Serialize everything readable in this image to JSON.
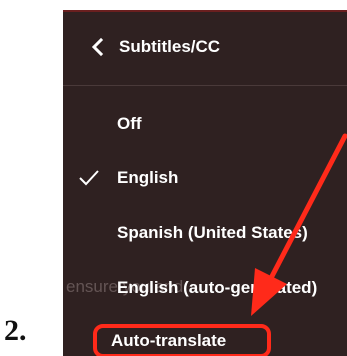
{
  "step": {
    "number": "2."
  },
  "panel": {
    "title": "Subtitles/CC",
    "items": [
      {
        "label": "Off",
        "selected": false
      },
      {
        "label": "English",
        "selected": true
      },
      {
        "label": "Spanish (United States)",
        "selected": false
      },
      {
        "label": "English (auto-generated)",
        "selected": false
      },
      {
        "label": "Auto-translate",
        "selected": false,
        "highlighted": true
      }
    ],
    "background_text": "ensure you and"
  },
  "colors": {
    "panel_bg": "#2f2121",
    "annotation_red": "#ff2a1a",
    "text": "#ffffff"
  },
  "icons": {
    "back": "chevron-left-icon",
    "selected": "checkmark-icon",
    "annotation": "red-arrow"
  }
}
